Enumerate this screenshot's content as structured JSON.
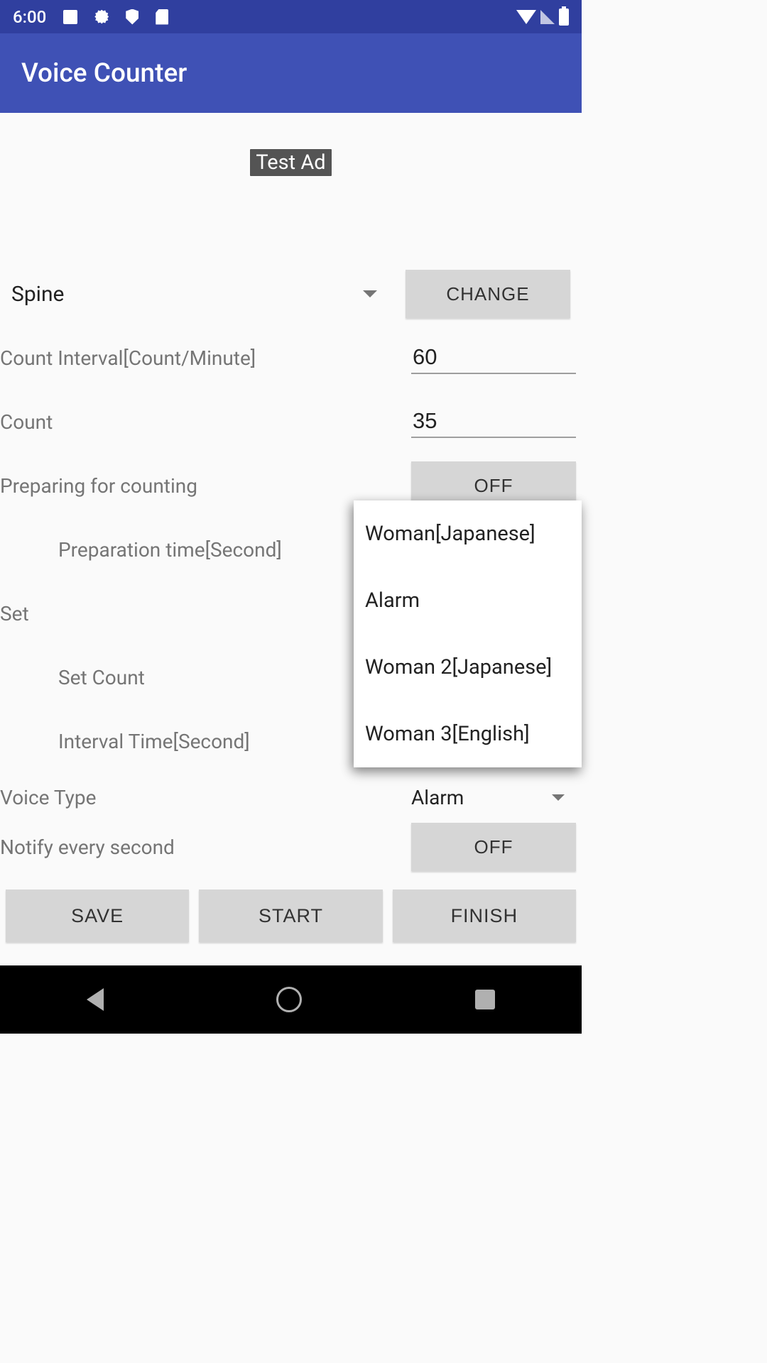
{
  "status": {
    "time": "6:00"
  },
  "app": {
    "title": "Voice Counter"
  },
  "ad": {
    "label": "Test Ad"
  },
  "form": {
    "preset": "Spine",
    "change_btn": "CHANGE",
    "count_interval_label": "Count Interval[Count/Minute]",
    "count_interval_value": "60",
    "count_label": "Count",
    "count_value": "35",
    "preparing_label": "Preparing for counting",
    "preparing_btn": "OFF",
    "prep_time_label": "Preparation time[Second]",
    "set_label": "Set",
    "set_count_label": "Set Count",
    "interval_time_label": "Interval Time[Second]",
    "voice_type_label": "Voice Type",
    "voice_type_value": "Alarm",
    "notify_label": "Notify every second",
    "notify_btn": "OFF"
  },
  "popup": {
    "items": [
      "Woman[Japanese]",
      "Alarm",
      "Woman 2[Japanese]",
      "Woman 3[English]"
    ]
  },
  "buttons": {
    "save": "SAVE",
    "start": "START",
    "finish": "FINISH"
  }
}
